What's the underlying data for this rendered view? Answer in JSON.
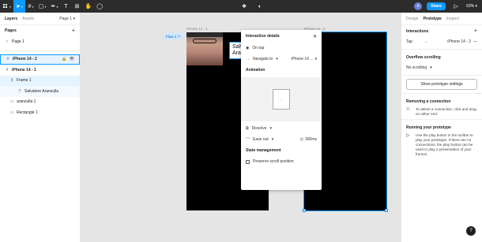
{
  "toolbar": {
    "main_menu_icon": "figma-menu-icon",
    "move_tool": "move-tool",
    "zoom": "63%",
    "share_label": "Share",
    "avatar_initial": "A"
  },
  "left_panel": {
    "tab_layers": "Layers",
    "tab_assets": "Assets",
    "page_selector": "Page 1",
    "pages_title": "Pages",
    "pages": [
      "Page 1"
    ],
    "layers": [
      {
        "label": "iPhone 14 - 2",
        "type": "frame"
      },
      {
        "label": "iPhone 14 - 1",
        "type": "frame"
      },
      {
        "label": "Frame 1",
        "type": "autolayout"
      },
      {
        "label": "Salvatore Aranzulla",
        "type": "text"
      },
      {
        "label": "aranzulla 1",
        "type": "image"
      },
      {
        "label": "Rectangle 1",
        "type": "rect"
      }
    ]
  },
  "canvas": {
    "frame1_label": "iPhone 14 - 1",
    "frame2_label": "iPhone 14 - 2",
    "flow_label": "Flow 1",
    "name_text_line1": "Salvatore",
    "name_text_line2": "Aranzulla"
  },
  "interaction_popup": {
    "title": "Interaction details",
    "trigger": "On tap",
    "action": "Navigate to",
    "destination": "iPhone 14 ...",
    "animation_title": "Animation",
    "animation_type": "Dissolve",
    "easing": "Ease out",
    "duration": "300ms",
    "state_title": "State management",
    "preserve_scroll": "Preserve scroll position"
  },
  "right_panel": {
    "tab_design": "Design",
    "tab_prototype": "Prototype",
    "tab_inspect": "Inspect",
    "interactions_title": "Interactions",
    "interaction_trigger": "Tap",
    "interaction_target": "iPhone 14 - 2",
    "overflow_title": "Overflow scrolling",
    "overflow_value": "No scrolling",
    "show_settings": "Show prototype settings",
    "removing_title": "Removing a connection",
    "removing_text": "To delete a connection, click and drag on either end.",
    "running_title": "Running your prototype",
    "running_text": "Use the play button in the toolbar to play your prototype. If there are no connections, the play button can be used to play a presentation of your frames.",
    "help": "?"
  }
}
